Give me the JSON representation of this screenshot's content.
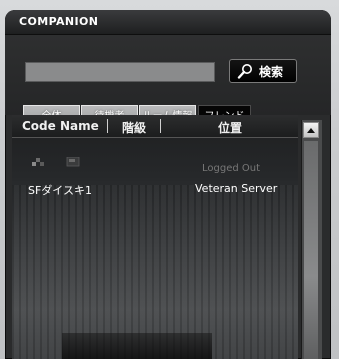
{
  "window": {
    "title": "COMPANION"
  },
  "search": {
    "value": "",
    "placeholder": "",
    "button_label": "検索"
  },
  "tabs": [
    {
      "label": "全体",
      "active": false
    },
    {
      "label": "待機者",
      "active": false
    },
    {
      "label": "ルーム情報",
      "active": false
    },
    {
      "label": "フレンド",
      "active": true
    }
  ],
  "list": {
    "columns": [
      "Code Name",
      "階級",
      "位置"
    ],
    "rows": [
      {
        "status": "Logged Out",
        "code_name": "SFダイスキ1",
        "rank": "",
        "location": "Veteran Server"
      }
    ]
  },
  "icons": {
    "search": "magnifier-icon",
    "scroll_up": "arrow-up-icon",
    "friend": "friend-status-icon"
  }
}
